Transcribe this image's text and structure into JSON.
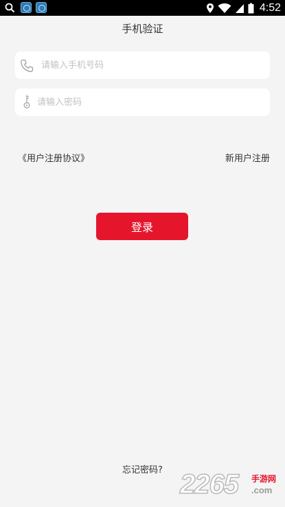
{
  "status_bar": {
    "time": "4:52",
    "icons": [
      "search-icon",
      "app-notification-icon",
      "app-notification-icon",
      "location-icon",
      "wifi-icon",
      "signal-icon",
      "battery-icon"
    ]
  },
  "header": {
    "title": "手机验证"
  },
  "form": {
    "phone": {
      "placeholder": "请输入手机号码",
      "value": "",
      "icon": "phone-icon"
    },
    "password": {
      "placeholder": "请输入密码",
      "value": "",
      "icon": "key-icon"
    }
  },
  "links": {
    "agreement": "《用户注册协议》",
    "register": "新用户注册",
    "forgot_password": "忘记密码?"
  },
  "login_button": {
    "label": "登录"
  },
  "watermark": {
    "number": "2265",
    "sub": "手游网",
    "domain": ".com"
  },
  "colors": {
    "accent": "#e5162c",
    "background": "#f4f4f4",
    "field_background": "#ffffff",
    "placeholder": "#c2c2c2",
    "text": "#333333"
  }
}
